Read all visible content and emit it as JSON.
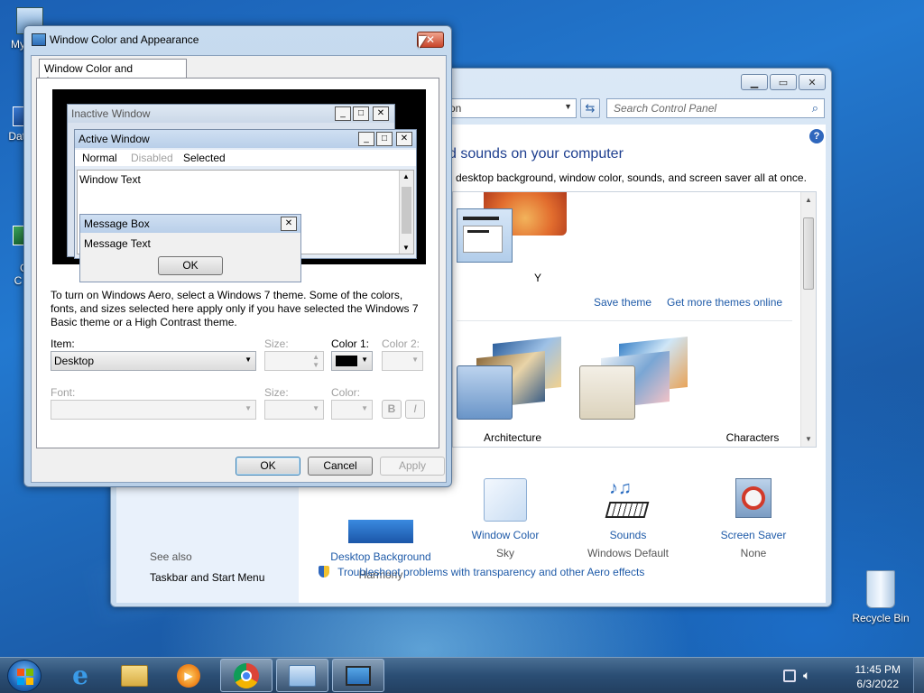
{
  "desktop": {
    "icons": [
      {
        "label": "My C"
      },
      {
        "label": "Data"
      },
      {
        "label": "G\nC"
      },
      {
        "label": "Recycle Bin"
      }
    ]
  },
  "control_panel": {
    "address_text": "on",
    "search_placeholder": "Search Control Panel",
    "heading": "d sounds on your computer",
    "subheading": "desktop background, window color, sounds, and screen saver all at once.",
    "selected_theme_label": "Y",
    "save_theme": "Save theme",
    "get_more_themes": "Get more themes online",
    "themes": [
      {
        "label": "Architecture"
      },
      {
        "label": "Characters"
      }
    ],
    "bottom_items": [
      {
        "title": "Desktop Background",
        "subtitle": "Harmony"
      },
      {
        "title": "Window Color",
        "subtitle": "Sky"
      },
      {
        "title": "Sounds",
        "subtitle": "Windows Default"
      },
      {
        "title": "Screen Saver",
        "subtitle": "None"
      }
    ],
    "see_also": "See also",
    "taskbar_link": "Taskbar and Start Menu",
    "troubleshoot": "Troubleshoot problems with transparency and other Aero effects"
  },
  "dialog": {
    "title": "Window Color and Appearance",
    "tab_label": "Window Color and Appearance",
    "preview": {
      "inactive_window": "Inactive Window",
      "active_window": "Active Window",
      "menu_normal": "Normal",
      "menu_disabled": "Disabled",
      "menu_selected": "Selected",
      "window_text": "Window Text",
      "message_box": "Message Box",
      "message_text": "Message Text",
      "ok": "OK"
    },
    "description": "To turn on Windows Aero, select a Windows 7 theme.  Some of the colors, fonts, and sizes selected here apply only if you have selected the Windows 7 Basic theme or a High Contrast theme.",
    "item_label": "Item:",
    "item_value": "Desktop",
    "size_label": "Size:",
    "color1_label": "Color 1:",
    "color1_value": "#000000",
    "color2_label": "Color 2:",
    "font_label": "Font:",
    "font_size_label": "Size:",
    "font_color_label": "Color:",
    "bold": "B",
    "italic": "I",
    "ok": "OK",
    "cancel": "Cancel",
    "apply": "Apply"
  },
  "taskbar": {
    "items": [
      "Internet Explorer",
      "Windows Explorer",
      "Windows Media Player",
      "Google Chrome",
      "Control Panel",
      "Window Color and Appearance"
    ],
    "time": "11:45 PM",
    "date": "6/3/2022"
  }
}
